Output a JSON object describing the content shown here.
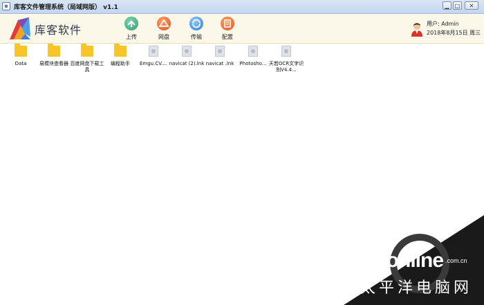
{
  "window": {
    "title": "库客文件管理系统（局域网版） v1.1",
    "controls": [
      "minimize",
      "maximize",
      "close"
    ]
  },
  "brand": {
    "name": "库客软件",
    "logo_icon": "kuke-logo-icon"
  },
  "toolbar": [
    {
      "id": "upload",
      "label": "上传",
      "icon": "upload-icon"
    },
    {
      "id": "disk",
      "label": "网盘",
      "icon": "cloud-disk-icon"
    },
    {
      "id": "transfer",
      "label": "传输",
      "icon": "transfer-icon"
    },
    {
      "id": "config",
      "label": "配置",
      "icon": "config-icon"
    }
  ],
  "user": {
    "line1": "用户: Admin",
    "line2": "2018年8月15日 周三",
    "avatar_icon": "user-avatar-icon"
  },
  "files": [
    {
      "name": "Data",
      "type": "folder"
    },
    {
      "name": "易模块查看器",
      "type": "folder"
    },
    {
      "name": "百度网盘下载工具",
      "type": "folder"
    },
    {
      "name": "编程助手",
      "type": "folder"
    },
    {
      "name": "Emgu.CV....",
      "type": "file"
    },
    {
      "name": "navicat (2).lnk",
      "type": "file"
    },
    {
      "name": "navicat .lnk",
      "type": "file"
    },
    {
      "name": "Photosho...",
      "type": "file"
    },
    {
      "name": "天若OCR文字识别V4.4...",
      "type": "file"
    }
  ],
  "watermark": {
    "brand": "PConline",
    "domain": ".com.cn",
    "cn": "太平洋电脑网"
  },
  "colors": {
    "header_bg": "#fbf8ea",
    "folder": "#f7c52a",
    "titlebar": "#c3d6ee"
  }
}
